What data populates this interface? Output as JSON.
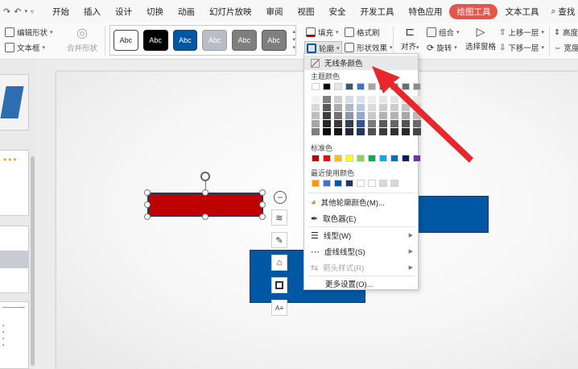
{
  "menubar": {
    "items": [
      "开始",
      "插入",
      "设计",
      "切换",
      "动画",
      "幻灯片放映",
      "审阅",
      "视图",
      "安全",
      "开发工具",
      "特色应用",
      "绘图工具",
      "文本工具"
    ],
    "active": "绘图工具",
    "search_label": "查找"
  },
  "ribbon": {
    "edit_shape": "编辑形状",
    "text_box": "文本框",
    "merge_shape": "合并形状",
    "style_label": "Abc",
    "fill": "填充",
    "format_brush": "格式刷",
    "outline": "轮廓",
    "shape_effect": "形状效果",
    "align": "对齐",
    "group": "组合",
    "rotate": "旋转",
    "select_pane": "选择窗格",
    "bring_forward": "上移一层",
    "send_backward": "下移一层",
    "height": "高度",
    "width": "宽度"
  },
  "gallery_styles": [
    {
      "bg": "#ffffff",
      "fg": "#222222",
      "border": "#444444"
    },
    {
      "bg": "#000000",
      "fg": "#ffffff",
      "border": "#000000"
    },
    {
      "bg": "#0057a3",
      "fg": "#ffffff",
      "border": "#1f3864"
    },
    {
      "bg": "#b9bec6",
      "fg": "#ffffff",
      "border": "#9aa0a8"
    },
    {
      "bg": "#7f7f7f",
      "fg": "#ffffff",
      "border": "#666666"
    },
    {
      "bg": "#7f7f7f",
      "fg": "#ffffff",
      "border": "#555555"
    }
  ],
  "dropdown": {
    "no_line_color": "无线条颜色",
    "theme_colors_label": "主题颜色",
    "standard_colors_label": "标准色",
    "recent_colors_label": "最近使用颜色",
    "more_outline_colors": "其他轮廓颜色(M)...",
    "eyedropper": "取色器(E)",
    "line_type": "线型(W)",
    "dash_type": "虚线线型(S)",
    "arrow_style": "箭头样式(R)",
    "more_settings": "更多设置(O)..."
  },
  "theme_top_row": [
    "#ffffff",
    "#000000",
    "#e7e6e6",
    "#44546a",
    "#4472c4",
    "#a5a5a5",
    "#5b5b5b",
    "#7f7f7f",
    "#6d6d6d",
    "#8c8c8c"
  ],
  "theme_grid": [
    [
      "#f2f2f2",
      "#d9d9d9",
      "#bfbfbf",
      "#a6a6a6",
      "#7f7f7f"
    ],
    [
      "#7f7f7f",
      "#595959",
      "#3f3f3f",
      "#262626",
      "#0c0c0c"
    ],
    [
      "#d0cece",
      "#aeabab",
      "#757171",
      "#3a3838",
      "#171616"
    ],
    [
      "#d6dce4",
      "#adb9ca",
      "#8497b0",
      "#333f4f",
      "#222a35"
    ],
    [
      "#d9e2f3",
      "#b4c6e7",
      "#8eaadb",
      "#2f5496",
      "#1f3864"
    ],
    [
      "#ededed",
      "#dbdbdb",
      "#c9c9c9",
      "#7b7b7b",
      "#525252"
    ],
    [
      "#e6e6e6",
      "#cdcdcd",
      "#b3b3b3",
      "#5a5a5a",
      "#3c3c3c"
    ],
    [
      "#e5e5e5",
      "#cccccc",
      "#b2b2b2",
      "#666666",
      "#333333"
    ],
    [
      "#e2e2e2",
      "#c5c5c5",
      "#a8a8a8",
      "#545454",
      "#2a2a2a"
    ],
    [
      "#e8e8e8",
      "#d1d1d1",
      "#bababa",
      "#696969",
      "#464646"
    ]
  ],
  "standard_colors": [
    "#c00000",
    "#ff0000",
    "#ffc000",
    "#ffff00",
    "#92d050",
    "#00b050",
    "#00b0f0",
    "#0070c0",
    "#002060",
    "#7030a0"
  ],
  "recent_colors": [
    "#ff9900",
    "#4472c4",
    "#0057a3",
    "#1f3864",
    "#ffffff",
    "#ffffff",
    "#d9d9d9",
    "#d9d9d9"
  ],
  "colors": {
    "accent": "#e6554a",
    "shape_red": "#c00000",
    "shape_blue": "#0057a3",
    "arrow_red": "#e8262b"
  }
}
